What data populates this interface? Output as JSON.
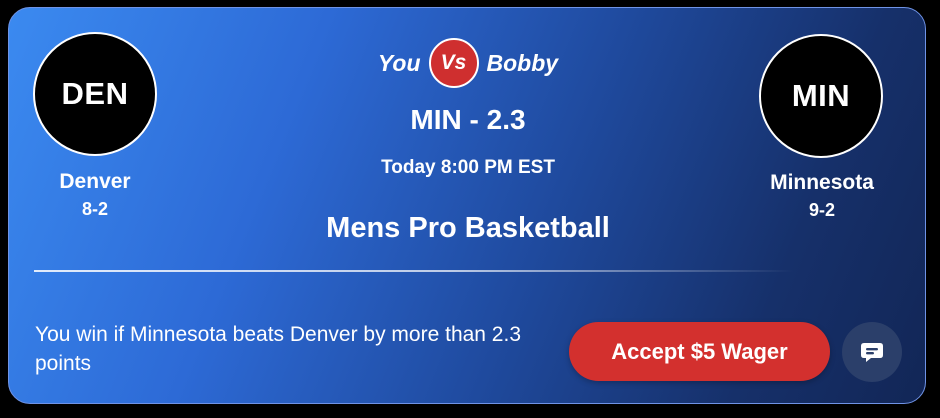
{
  "matchup": {
    "left_player": "You",
    "vs_label": "Vs",
    "right_player": "Bobby"
  },
  "away_team": {
    "abbr": "DEN",
    "name": "Denver",
    "record": "8-2"
  },
  "home_team": {
    "abbr": "MIN",
    "name": "Minnesota",
    "record": "9-2"
  },
  "game": {
    "spread": "MIN - 2.3",
    "time": "Today 8:00 PM EST",
    "league": "Mens Pro Basketball"
  },
  "wager": {
    "condition_text": "You win if Minnesota beats Denver by more than 2.3 points",
    "accept_label": "Accept $5 Wager"
  },
  "icons": {
    "chat": "chat-bubble-icon"
  },
  "colors": {
    "accent_red": "#d3302e",
    "gradient_start": "#3b8af0",
    "gradient_end": "#122656"
  }
}
